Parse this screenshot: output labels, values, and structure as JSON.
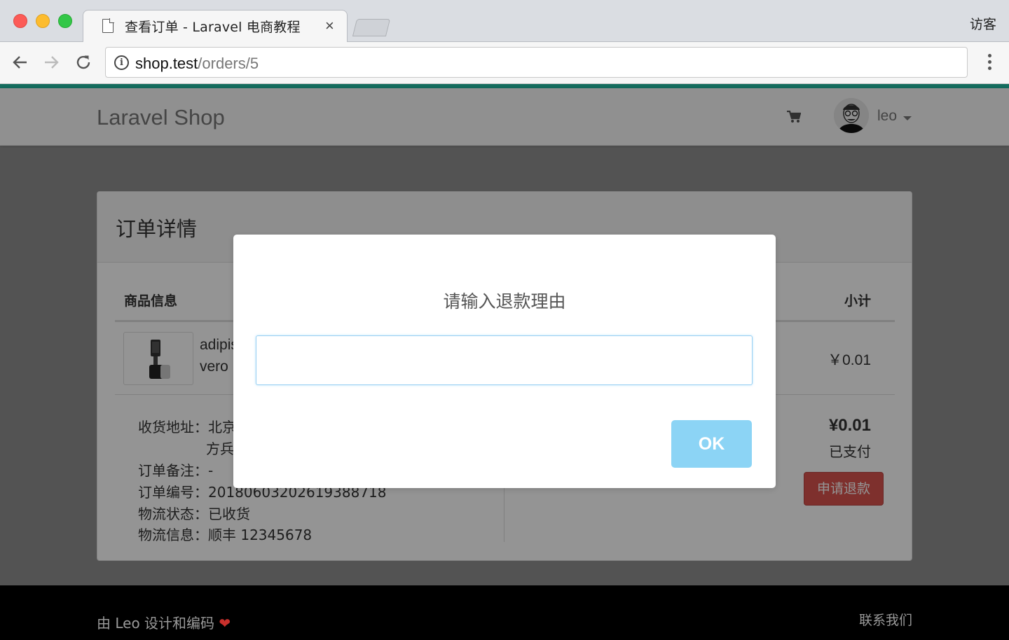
{
  "browser": {
    "tab_title": "查看订单 - Laravel 电商教程",
    "tab_close": "×",
    "guest_label": "访客",
    "url_host": "shop.test",
    "url_path": "/orders/5",
    "info_icon": "i"
  },
  "navbar": {
    "brand": "Laravel Shop",
    "user_name": "leo"
  },
  "panel": {
    "title": "订单详情",
    "col_product": "商品信息",
    "col_subtotal": "小计",
    "product_title_line1": "adipisci",
    "product_title_line2": "vero",
    "row_subtotal": "￥0.01",
    "address_label": "收货地址：",
    "address_value_1": "北京",
    "address_value_2": "方兵",
    "remark": "订单备注：-",
    "order_no": "订单编号：20180603202619388718",
    "ship_status": "物流状态：已收货",
    "ship_info": "物流信息：顺丰 12345678",
    "total": "¥0.01",
    "paid_status": "已支付",
    "refund_button": "申请退款"
  },
  "footer": {
    "left_text": "由 Leo 设计和编码",
    "heart": "❤",
    "right_text": "联系我们"
  },
  "modal": {
    "title": "请输入退款理由",
    "input_value": "",
    "ok_label": "OK"
  },
  "colors": {
    "accent_bar": "#146c5e",
    "ok_button": "#8cd4f5",
    "refund_button": "#d9534f"
  },
  "icons": [
    "document-icon",
    "close-icon",
    "back-arrow-icon",
    "forward-arrow-icon",
    "reload-icon",
    "info-icon",
    "menu-kebab-icon",
    "cart-icon",
    "avatar",
    "caret-down-icon",
    "heart-icon"
  ]
}
